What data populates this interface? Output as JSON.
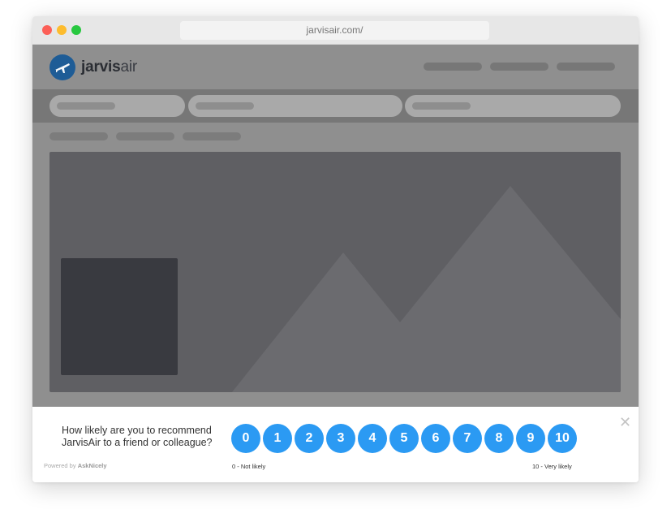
{
  "browser": {
    "url": "jarvisair.com/"
  },
  "site": {
    "logo_bold": "jarvis",
    "logo_light": "air"
  },
  "survey": {
    "question": "How likely are you to recommend JarvisAir to a friend or colleague?",
    "scores": [
      "0",
      "1",
      "2",
      "3",
      "4",
      "5",
      "6",
      "7",
      "8",
      "9",
      "10"
    ],
    "low_label": "0 - Not likely",
    "high_label": "10 - Very likely",
    "powered_prefix": "Powered by ",
    "powered_brand": "AskNicely",
    "close_glyph": "✕",
    "accent_color": "#2b9af3"
  }
}
